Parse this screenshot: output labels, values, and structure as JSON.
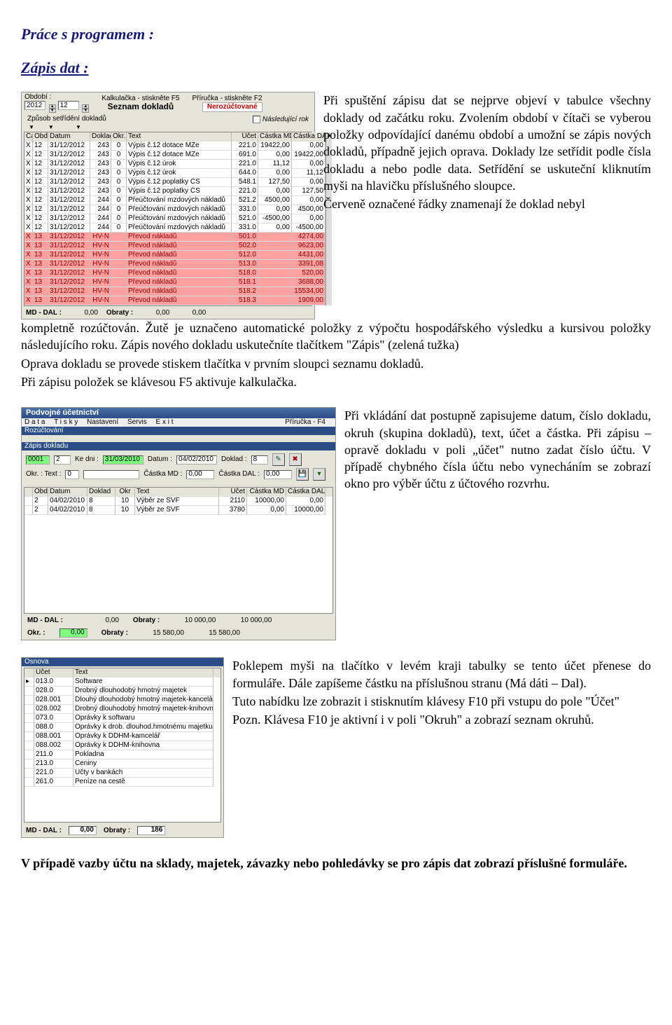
{
  "h1": "Práce s programem :",
  "h2": "Zápis dat :",
  "shot1": {
    "lblObdobi": "Období :",
    "year": "2012",
    "month": "12",
    "lblKalk": "Kalkulačka - stiskněte F5",
    "lblPri": "Příručka - stiskněte F2",
    "title": "Seznam dokladů",
    "btnNeroz": "Nerozúčtované",
    "lblZpusob": "Způsob setřídění dokladů",
    "lblNasl": "Následující rok",
    "headers": {
      "ca": "Ča",
      "obd": "Obd.",
      "dat": "Datum",
      "dok": "Doklad",
      "okr": "Okr.",
      "txt": "Text",
      "ucet": "Účet",
      "md": "Částka MD",
      "dal": "Částka DAL"
    },
    "rows": [
      {
        "ca": "X",
        "obd": "12",
        "dat": "31/12/2012",
        "dok": "243",
        "okr": "0",
        "txt": "Výpis č.12 dotace MZe",
        "ucet": "221.0",
        "md": "19422,00",
        "dal": "0,00",
        "cls": ""
      },
      {
        "ca": "X",
        "obd": "12",
        "dat": "31/12/2012",
        "dok": "243",
        "okr": "0",
        "txt": "Výpis č.12 dotace MZe",
        "ucet": "691.0",
        "md": "0,00",
        "dal": "19422,00",
        "cls": ""
      },
      {
        "ca": "X",
        "obd": "12",
        "dat": "31/12/2012",
        "dok": "243",
        "okr": "0",
        "txt": "Výpis č.12 úrok",
        "ucet": "221.0",
        "md": "11,12",
        "dal": "0,00",
        "cls": ""
      },
      {
        "ca": "X",
        "obd": "12",
        "dat": "31/12/2012",
        "dok": "243",
        "okr": "0",
        "txt": "Výpis č.12 úrok",
        "ucet": "644.0",
        "md": "0,00",
        "dal": "11,12",
        "cls": ""
      },
      {
        "ca": "X",
        "obd": "12",
        "dat": "31/12/2012",
        "dok": "243",
        "okr": "0",
        "txt": "Výpis č.12 poplatky ČS",
        "ucet": "548.1",
        "md": "127,50",
        "dal": "0,00",
        "cls": ""
      },
      {
        "ca": "X",
        "obd": "12",
        "dat": "31/12/2012",
        "dok": "243",
        "okr": "0",
        "txt": "Výpis č.12 poplatky ČS",
        "ucet": "221.0",
        "md": "0,00",
        "dal": "127,50",
        "cls": ""
      },
      {
        "ca": "X",
        "obd": "12",
        "dat": "31/12/2012",
        "dok": "244",
        "okr": "0",
        "txt": "Přeúčtování mzdových nákladů",
        "ucet": "521.2",
        "md": "4500,00",
        "dal": "0,00",
        "cls": ""
      },
      {
        "ca": "X",
        "obd": "12",
        "dat": "31/12/2012",
        "dok": "244",
        "okr": "0",
        "txt": "Přeúčtování mzdových nákladů",
        "ucet": "331.0",
        "md": "0,00",
        "dal": "4500,00",
        "cls": ""
      },
      {
        "ca": "X",
        "obd": "12",
        "dat": "31/12/2012",
        "dok": "244",
        "okr": "0",
        "txt": "Přeúčtování mzdových nákladů",
        "ucet": "521.0",
        "md": "-4500,00",
        "dal": "0,00",
        "cls": ""
      },
      {
        "ca": "X",
        "obd": "12",
        "dat": "31/12/2012",
        "dok": "244",
        "okr": "0",
        "txt": "Přeúčtování mzdových nákladů",
        "ucet": "331.0",
        "md": "0,00",
        "dal": "-4500,00",
        "cls": ""
      },
      {
        "ca": "X",
        "obd": "13",
        "dat": "31/12/2012",
        "dok": "HV-N",
        "okr": "",
        "txt": "Převod nákladů",
        "ucet": "501.0",
        "md": "",
        "dal": "4274,00",
        "cls": "red"
      },
      {
        "ca": "X",
        "obd": "13",
        "dat": "31/12/2012",
        "dok": "HV-N",
        "okr": "",
        "txt": "Převod nákladů",
        "ucet": "502.0",
        "md": "",
        "dal": "9623,00",
        "cls": "red"
      },
      {
        "ca": "X",
        "obd": "13",
        "dat": "31/12/2012",
        "dok": "HV-N",
        "okr": "",
        "txt": "Převod nákladů",
        "ucet": "512.0",
        "md": "",
        "dal": "4431,00",
        "cls": "red"
      },
      {
        "ca": "X",
        "obd": "13",
        "dat": "31/12/2012",
        "dok": "HV-N",
        "okr": "",
        "txt": "Převod nákladů",
        "ucet": "513.0",
        "md": "",
        "dal": "3391,08",
        "cls": "red"
      },
      {
        "ca": "X",
        "obd": "13",
        "dat": "31/12/2012",
        "dok": "HV-N",
        "okr": "",
        "txt": "Převod nákladů",
        "ucet": "518.0",
        "md": "",
        "dal": "520,00",
        "cls": "red"
      },
      {
        "ca": "X",
        "obd": "13",
        "dat": "31/12/2012",
        "dok": "HV-N",
        "okr": "",
        "txt": "Převod nákladů",
        "ucet": "518.1",
        "md": "",
        "dal": "3688,00",
        "cls": "red"
      },
      {
        "ca": "X",
        "obd": "13",
        "dat": "31/12/2012",
        "dok": "HV-N",
        "okr": "",
        "txt": "Převod nákladů",
        "ucet": "518.2",
        "md": "",
        "dal": "15534,00",
        "cls": "red"
      },
      {
        "ca": "X",
        "obd": "13",
        "dat": "31/12/2012",
        "dok": "HV-N",
        "okr": "",
        "txt": "Převod nákladů",
        "ucet": "518.3",
        "md": "",
        "dal": "1909,00",
        "cls": "red"
      }
    ],
    "ftr": {
      "mddal": "MD - DAL :",
      "v1": "0,00",
      "obraty": "Obraty :",
      "v2": "0,00",
      "v3": "0,00"
    }
  },
  "para1a": "Při spuštění zápisu dat se nejprve objeví v tabulce všechny doklady od začátku roku. Zvolením období v čítači se vyberou položky odpovídající danému období a umožní se zápis nových dokladů, případně jejich oprava. Doklady lze setřídit podle čísla dokladu a nebo podle data. Setřídění se uskuteční kliknutím myši na hlavičku příslušného sloupce.",
  "para1b": "Červeně označené řádky znamenají že doklad nebyl",
  "para1c": "kompletně rozúčtován. Žutě je uznačeno automatické položky z výpočtu hospodářského výsledku a kursivou položky následujícího roku. Zápis nového dokladu uskutečníte tlačítkem \"Zápis\" (zelená tužka)",
  "para1d": "Oprava dokladu se provede stiskem tlačítka v prvním sloupci seznamu dokladů.",
  "para1e": "Při zápisu položek se klávesou F5 aktivuje kalkulačka.",
  "shot2": {
    "titlebar": "Podvojné účetnictví",
    "menu": [
      "D a t a",
      "T i s k y",
      "Nastavení",
      "Servis",
      "E x i t"
    ],
    "pri": "Příručka - F4",
    "bluehdr": "Rozúčtování",
    "panelTitle": "Zápis dokladu",
    "fld": {
      "id1": "0001",
      "id2": "2",
      "lblKeDni": "Ke dni :",
      "kedni": "31/03/2010",
      "lblDatum": "Datum :",
      "datum": "04/02/2010",
      "lblDoklad": "Doklad :",
      "doklad": "8",
      "lblOkrTxt": "Okr. : Text :",
      "okr": "0",
      "lblMD": "Částka MD :",
      "md": "0,00",
      "lblDAL": "Částka DAL :",
      "dal": "0,00"
    },
    "headers": {
      "a": "",
      "obd": "Obd",
      "dat": "Datum",
      "dok": "Doklad",
      "okr": "Okr",
      "txt": "Text",
      "uc": "Účet",
      "md": "Částka MD",
      "dal": "Částka DAL"
    },
    "rows": [
      {
        "a": "",
        "obd": "2",
        "dat": "04/02/2010",
        "dok": "8",
        "okr": "10",
        "txt": "Výběr ze SVF",
        "uc": "2110",
        "md": "10000,00",
        "dal": "0,00"
      },
      {
        "a": "",
        "obd": "2",
        "dat": "04/02/2010",
        "dok": "8",
        "okr": "10",
        "txt": "Výběr ze SVF",
        "uc": "3780",
        "md": "0,00",
        "dal": "10000,00"
      }
    ],
    "ftrA": {
      "mddal": "MD - DAL :",
      "v1": "0,00",
      "obraty": "Obraty :",
      "v2": "10 000,00",
      "v3": "10 000,00"
    },
    "ftrB": {
      "okrlbl": "Okr. :",
      "okr": "0,00",
      "obraty": "Obraty :",
      "v2": "15 580,00",
      "v3": "15 580,00"
    }
  },
  "para2": "Při vkládání dat postupně zapisujeme datum, číslo dokladu, okruh (skupina dokladů), text, účet a částka. Při zápisu – opravě dokladu v poli „účet\" nutno zadat číslo účtu. V případě chybného čísla účtu nebo vynecháním se zobrazí okno pro výběr účtu z účtového rozvrhu.",
  "shot3": {
    "bluehdr": "Osnova",
    "headers": {
      "a": "",
      "uc": "Účet",
      "txt": "Text"
    },
    "rows": [
      {
        "a": "▸",
        "uc": "013.0",
        "txt": "Software"
      },
      {
        "a": "",
        "uc": "028.0",
        "txt": "Drobný dlouhodobý hmotný majetek"
      },
      {
        "a": "",
        "uc": "028.001",
        "txt": "Dlouhý dlouhodobý hmotný majetek-kancelář"
      },
      {
        "a": "",
        "uc": "028.002",
        "txt": "Drobný dlouhodobý hmotný majetek-knihovna"
      },
      {
        "a": "",
        "uc": "073.0",
        "txt": "Oprávky k softwaru"
      },
      {
        "a": "",
        "uc": "088.0",
        "txt": "Oprávky k drob. dlouhod.hmotnému majetku"
      },
      {
        "a": "",
        "uc": "088.001",
        "txt": "Oprávky k DDHM-kamcelář"
      },
      {
        "a": "",
        "uc": "088.002",
        "txt": "Oprávky k DDHM-knihovna"
      },
      {
        "a": "",
        "uc": "211.0",
        "txt": "Pokladna"
      },
      {
        "a": "",
        "uc": "213.0",
        "txt": "Ceniny"
      },
      {
        "a": "",
        "uc": "221.0",
        "txt": "Účty v bankách"
      },
      {
        "a": "",
        "uc": "261.0",
        "txt": "Peníze na cestě"
      }
    ],
    "ftr": {
      "mddal": "MD - DAL :",
      "v1": "0,00",
      "obraty": "Obraty :",
      "v2": "186"
    }
  },
  "para3a": "Poklepem myši na tlačítko v levém kraji tabulky se tento účet přenese do formuláře. Dále zapíšeme částku na příslušnou stranu (Má dáti – Dal).",
  "para3b": "Tuto nabídku lze zobrazit i stisknutím klávesy F10 při vstupu do pole \"Účet\"",
  "para3c": "Pozn. Klávesa F10 je aktivní i v poli \"Okruh\" a zobrazí seznam okruhů.",
  "final": "V případě vazby účtu na sklady, majetek, závazky nebo pohledávky se pro zápis dat zobrazí příslušné formuláře."
}
